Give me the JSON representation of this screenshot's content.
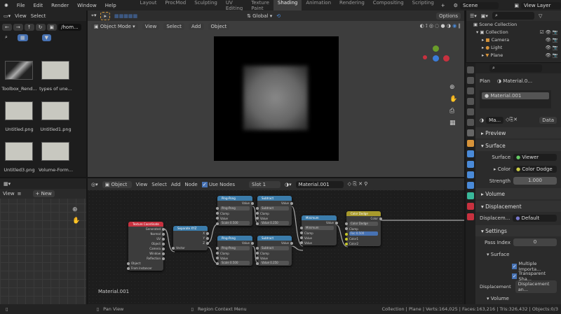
{
  "topbar": {
    "menus": [
      "File",
      "Edit",
      "Render",
      "Window",
      "Help"
    ],
    "tabs": [
      "Layout",
      "ProcMod",
      "Sculpting",
      "UV Editing",
      "Texture Paint",
      "Shading",
      "Animation",
      "Rendering",
      "Compositing",
      "Scripting"
    ],
    "active_tab": "Shading",
    "scene": "Scene",
    "view_layer": "View Layer"
  },
  "file_browser": {
    "view": "View",
    "select": "Select",
    "path": "/hom...",
    "files": [
      "Toolbox_Rend...",
      "types of une...",
      "Untitled.png",
      "Untitled1.png",
      "Untitled3.png",
      "Volume-Form..."
    ]
  },
  "viewport": {
    "mode": "Object Mode",
    "menus": [
      "View",
      "Select",
      "Add",
      "Object"
    ],
    "orientation": "Global",
    "options": "Options"
  },
  "image_editor": {
    "view": "View",
    "new": "New"
  },
  "node_editor": {
    "type": "Object",
    "menus": [
      "View",
      "Select",
      "Add",
      "Node"
    ],
    "use_nodes": "Use Nodes",
    "slot": "Slot 1",
    "material": "Material.001",
    "label": "Material.001",
    "nodes": [
      {
        "title": "Texture Coordinate",
        "color": "#c8313f",
        "rows": [
          "Generated",
          "Normal",
          "UV",
          "Object",
          "Camera",
          "Window",
          "Reflection",
          "Object:",
          "From Instancer"
        ]
      },
      {
        "title": "Separate XYZ",
        "color": "#3b7cab",
        "rows": [
          "X",
          "Y",
          "Z",
          "Vector"
        ]
      },
      {
        "title": "Ping-Pong",
        "color": "#3b7cab",
        "rows": [
          "Value",
          "Ping-Pong",
          "Clamp",
          "Value",
          "Scale 0.500"
        ]
      },
      {
        "title": "Ping-Pong",
        "color": "#3b7cab",
        "rows": [
          "Value",
          "Ping-Pong",
          "Clamp",
          "Value",
          "Scale 0.500"
        ]
      },
      {
        "title": "Subtract",
        "color": "#3b7cab",
        "rows": [
          "Value",
          "Subtract",
          "Clamp",
          "Value",
          "Value 0.250"
        ]
      },
      {
        "title": "Subtract",
        "color": "#3b7cab",
        "rows": [
          "Value",
          "Subtract",
          "Clamp",
          "Value",
          "Value 0.250"
        ]
      },
      {
        "title": "Minimum",
        "color": "#3b7cab",
        "rows": [
          "Value",
          "Minimum",
          "Clamp",
          "Value",
          "Value"
        ]
      },
      {
        "title": "Color Dodge",
        "color": "#a89a2c",
        "rows": [
          "Color",
          "Color Dodge",
          "Clamp",
          "Fac 0.500",
          "Color1",
          "Color2"
        ]
      }
    ]
  },
  "outliner": {
    "root": "Scene Collection",
    "collection": "Collection",
    "items": [
      "Camera",
      "Light",
      "Plane"
    ]
  },
  "properties": {
    "object": "Plan",
    "material_short": "Material.0...",
    "slot": "Material.001",
    "mat_field": "Ma...",
    "data": "Data",
    "preview": "Preview",
    "surface": "Surface",
    "surface_label": "Surface",
    "surface_value": "Viewer",
    "color_label": "Color",
    "color_value": "Color Dodge",
    "strength_label": "Strength",
    "strength_value": "1.000",
    "volume": "Volume",
    "displacement": "Displacement",
    "disp_label": "Displacem...",
    "disp_value": "Default",
    "settings": "Settings",
    "pass_index_label": "Pass Index",
    "pass_index": "0",
    "sub_surface": "Surface",
    "multiple_importance": "Multiple Importa...",
    "transparent_shadow": "Transparent Sha...",
    "disp_method_label": "Displacement",
    "disp_method": "Displacement an...",
    "sub_volume": "Volume"
  },
  "status": {
    "pan": "Pan View",
    "context": "Region Context Menu",
    "stats": "Collection | Plane | Verts:164,025 | Faces:163,216 | Tris:326,432 | Objects:0/3"
  }
}
